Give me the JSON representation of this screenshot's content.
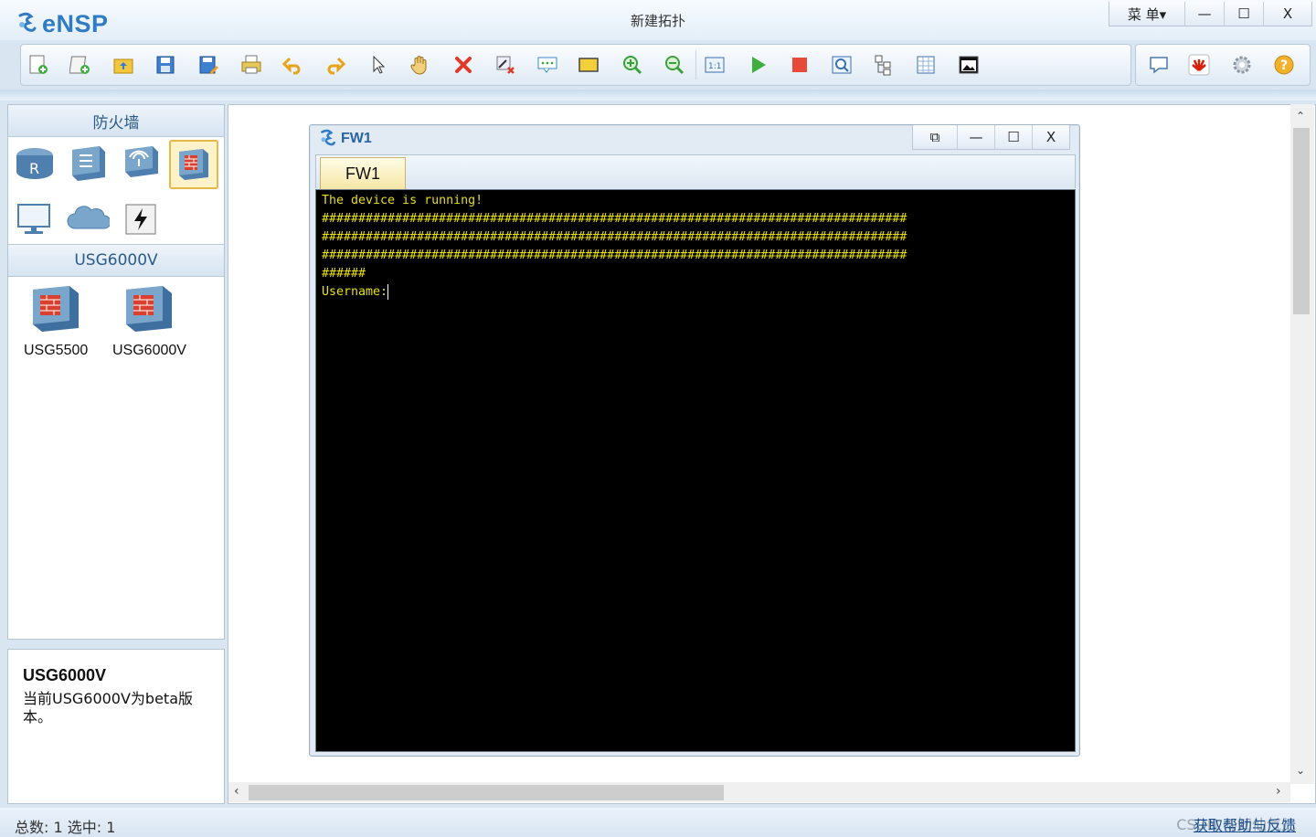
{
  "app": {
    "name": "eNSP",
    "doc_title": "新建拓扑",
    "menu_label": "菜 单▾"
  },
  "window_controls": {
    "minimize": "—",
    "maximize": "☐",
    "close": "X"
  },
  "toolbar": {
    "main_icons": [
      "new-topology-icon",
      "new-example-icon",
      "open-icon",
      "save-icon",
      "save-as-icon",
      "print-icon",
      "undo-icon",
      "redo-icon",
      "select-pointer-icon",
      "pan-hand-icon",
      "delete-icon",
      "delete-link-icon",
      "text-comment-icon",
      "rectangle-icon",
      "zoom-in-icon",
      "zoom-out-icon",
      "fit-view-icon",
      "start-device-icon",
      "stop-device-icon",
      "capture-icon",
      "topology-icon",
      "grid-icon",
      "snapshot-icon"
    ],
    "right_icons": [
      "chat-icon",
      "huawei-icon",
      "settings-gear-icon",
      "help-icon"
    ]
  },
  "left_panel": {
    "category_title": "防火墙",
    "category_icons": [
      "router-icon",
      "switch-icon",
      "wireless-icon",
      "firewall-icon",
      "pc-icon",
      "cloud-icon",
      "power-icon"
    ],
    "section_title": "USG6000V",
    "devices": [
      {
        "label": "USG5500"
      },
      {
        "label": "USG6000V"
      }
    ]
  },
  "description": {
    "title": "USG6000V",
    "text": "当前USG6000V为beta版本。"
  },
  "terminal": {
    "title": "FW1",
    "tab": "FW1",
    "controls": {
      "restore": "⧉",
      "minimize": "—",
      "maximize": "☐",
      "close": "X"
    },
    "lines": [
      "The device is running!",
      "################################################################################",
      "################################################################################",
      "################################################################################",
      "######"
    ],
    "prompt": "Username:"
  },
  "status": {
    "text": "总数: 1 选中: 1",
    "watermark": "CSDN @知仙气儿",
    "link": "获取帮助与反馈"
  }
}
